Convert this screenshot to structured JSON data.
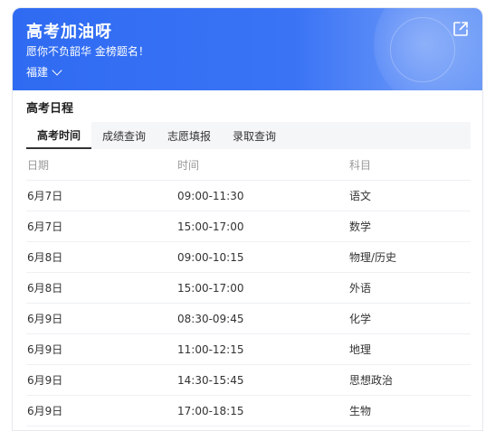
{
  "banner": {
    "title": "高考加油呀",
    "subtitle": "愿你不负韶华 金榜题名！",
    "region": "福建",
    "share_icon": "share-icon"
  },
  "section_title": "高考日程",
  "tabs": [
    {
      "label": "高考时间",
      "active": true
    },
    {
      "label": "成绩查询",
      "active": false
    },
    {
      "label": "志愿填报",
      "active": false
    },
    {
      "label": "录取查询",
      "active": false
    }
  ],
  "table": {
    "headers": [
      "日期",
      "时间",
      "科目"
    ],
    "rows": [
      [
        "6月7日",
        "09:00-11:30",
        "语文"
      ],
      [
        "6月7日",
        "15:00-17:00",
        "数学"
      ],
      [
        "6月8日",
        "09:00-10:15",
        "物理/历史"
      ],
      [
        "6月8日",
        "15:00-17:00",
        "外语"
      ],
      [
        "6月9日",
        "08:30-09:45",
        "化学"
      ],
      [
        "6月9日",
        "11:00-12:15",
        "地理"
      ],
      [
        "6月9日",
        "14:30-15:45",
        "思想政治"
      ],
      [
        "6月9日",
        "17:00-18:15",
        "生物"
      ]
    ]
  },
  "colors": {
    "banner": "#2f6bf2",
    "header_text": "#999999",
    "body_text": "#333333"
  }
}
